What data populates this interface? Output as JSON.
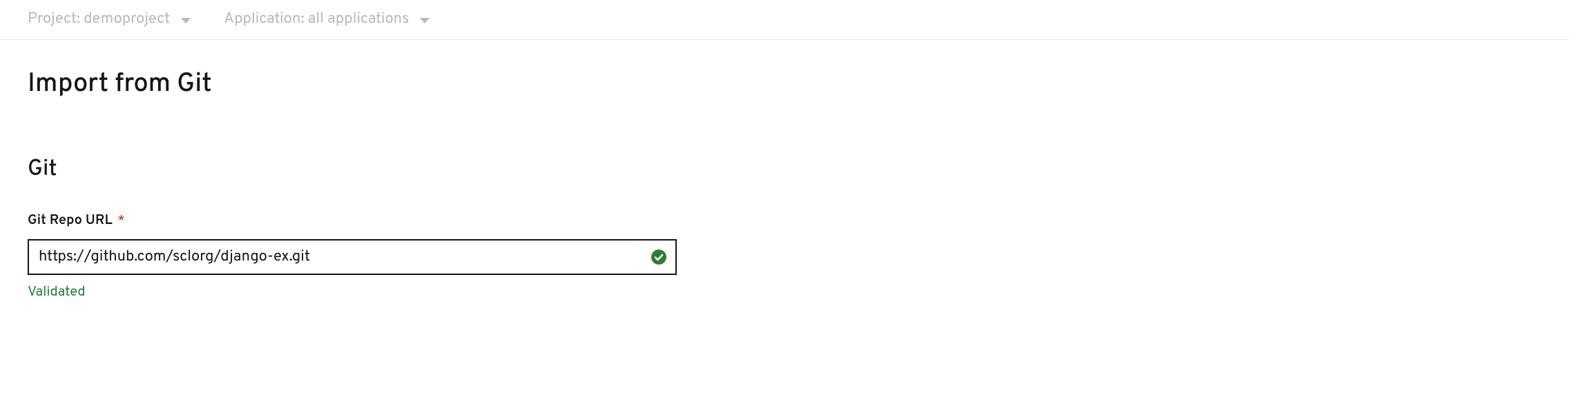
{
  "topbar": {
    "project": {
      "label": "Project: demoproject"
    },
    "application": {
      "label": "Application: all applications"
    }
  },
  "page": {
    "title": "Import from Git"
  },
  "section": {
    "title": "Git"
  },
  "form": {
    "gitRepoUrl": {
      "label": "Git Repo URL",
      "required_marker": "*",
      "value": "https://github.com/sclorg/django-ex.git",
      "status_text": "Validated"
    }
  },
  "colors": {
    "success": "#2e7d32",
    "muted": "#b8b8b8",
    "danger": "#c9190b"
  }
}
